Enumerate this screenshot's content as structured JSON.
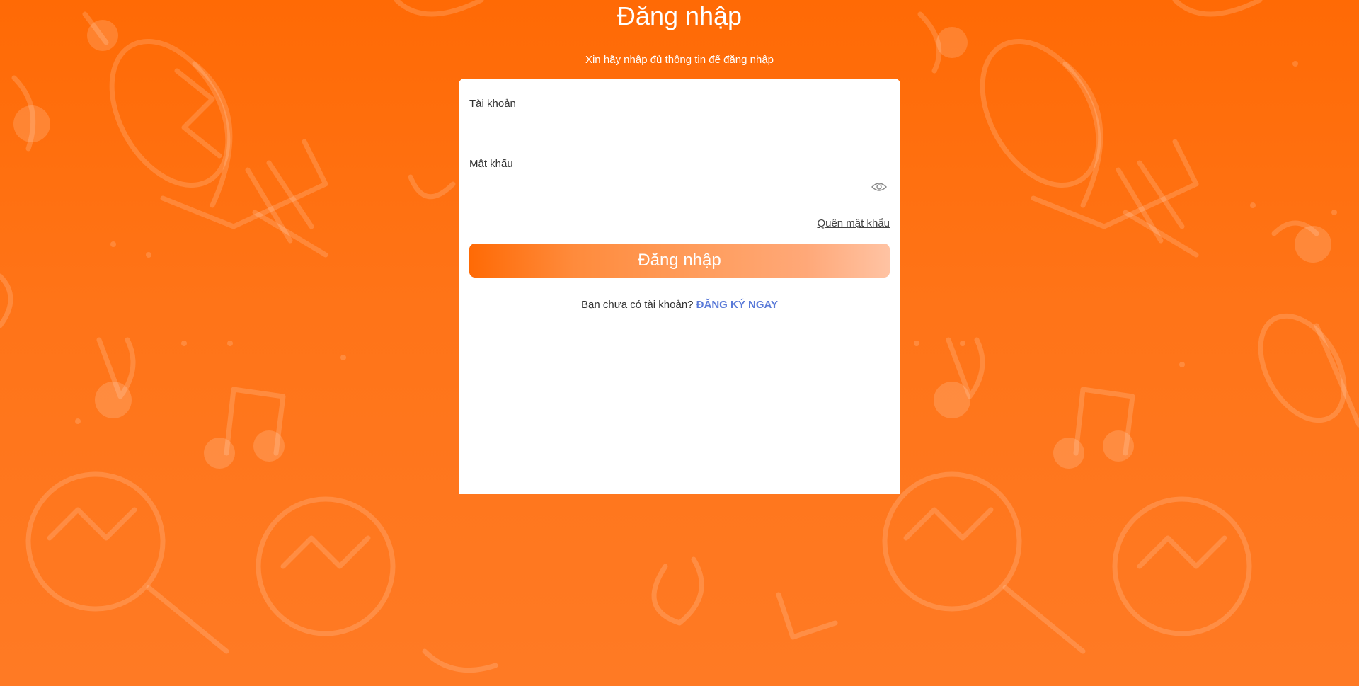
{
  "page": {
    "title": "Đăng nhập",
    "subtitle": "Xin hãy nhập đủ thông tin để đăng nhập"
  },
  "form": {
    "username_label": "Tài khoản",
    "username_value": "",
    "password_label": "Mật khẩu",
    "password_value": "",
    "password_toggle_icon": "eye-icon",
    "forgot_password": "Quên mật khẩu",
    "submit_label": "Đăng nhập",
    "signup_prompt": "Bạn chưa có tài khoản?",
    "signup_link": "ĐĂNG KÝ NGAY"
  },
  "colors": {
    "background": "#ff6a05",
    "link": "#5a7ad8",
    "button_start": "#ff6a05",
    "button_end": "#ffc3a3"
  }
}
